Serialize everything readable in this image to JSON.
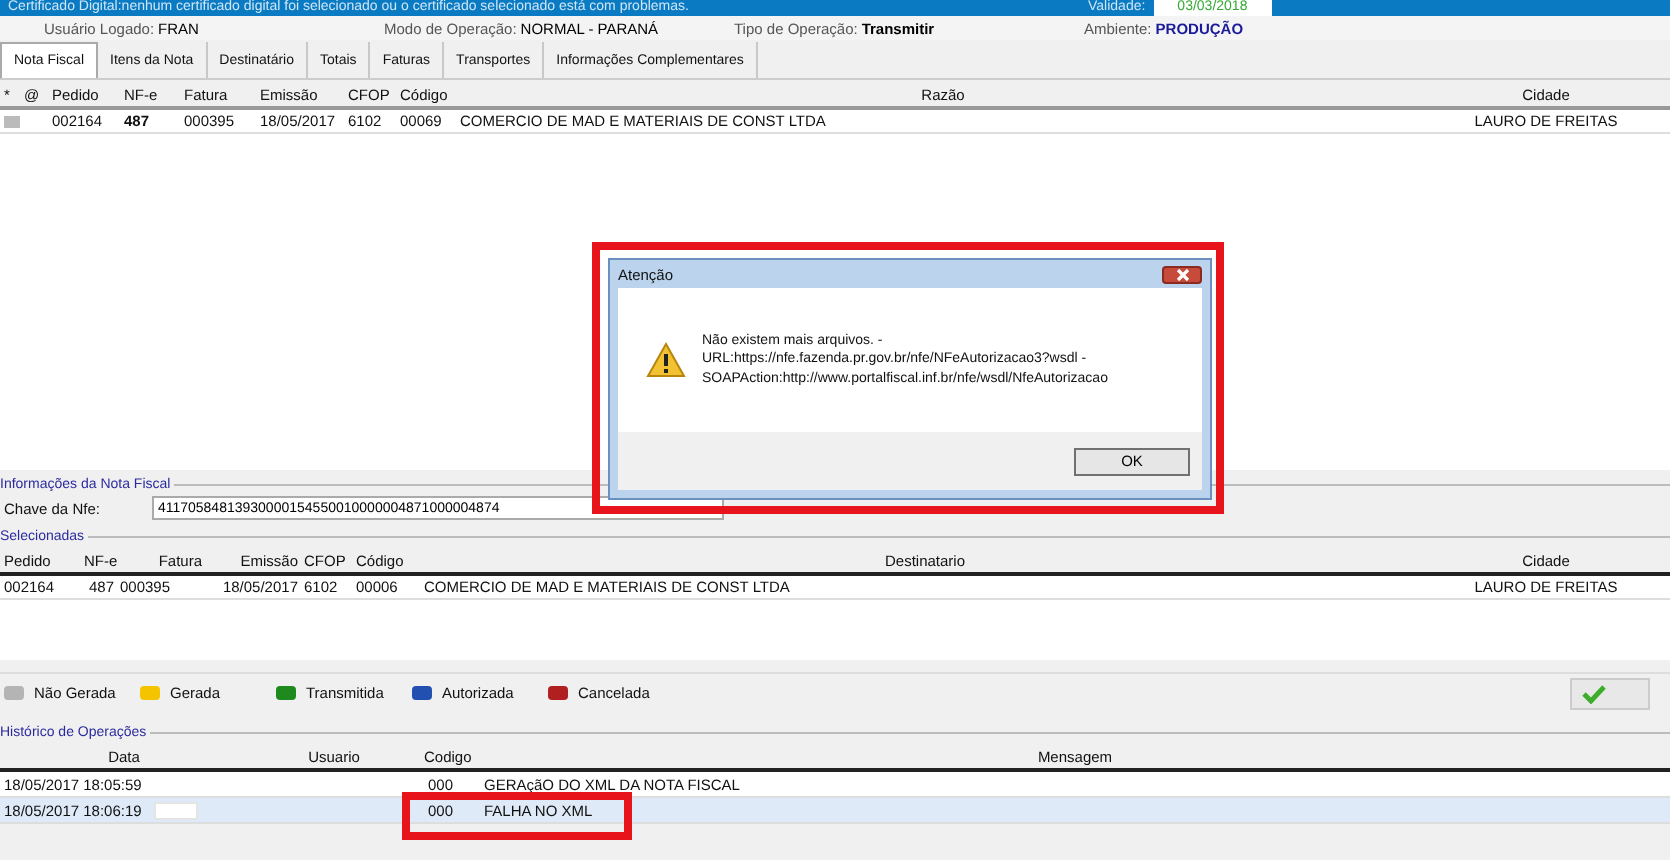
{
  "banner": {
    "text": "Certificado Digital:nenhum certificado digital foi selecionado ou o certificado selecionado está com problemas.",
    "validade_label": "Validade:",
    "validade_value": "03/03/2018"
  },
  "header": [
    {
      "label": "Usuário Logado:",
      "value": "FRAN",
      "color": "#000000"
    },
    {
      "label": "Modo de Operação:",
      "value": "NORMAL - PARANÁ",
      "color": "#000000"
    },
    {
      "label": "Tipo de Operação:",
      "value": "Transmitir",
      "color": "#000000"
    },
    {
      "label": "Ambiente:",
      "value": "PRODUÇÃO",
      "color": "#1a1a9a"
    }
  ],
  "tabs": [
    {
      "label": "Nota Fiscal",
      "selected": true
    },
    {
      "label": "Itens da Nota",
      "selected": false
    },
    {
      "label": "Destinatário",
      "selected": false
    },
    {
      "label": "Totais",
      "selected": false
    },
    {
      "label": "Faturas",
      "selected": false
    },
    {
      "label": "Transportes",
      "selected": false
    },
    {
      "label": "Informações Complementares",
      "selected": false
    }
  ],
  "notas_table": {
    "columns": [
      "*",
      "@",
      "Pedido",
      "NF-e",
      "Fatura",
      "Emissão",
      "CFOP",
      "Código",
      "Razão",
      "Cidade"
    ],
    "rows": [
      {
        "cells": [
          "",
          "",
          "002164",
          "487",
          "000395",
          "18/05/2017",
          "6102",
          "00069",
          "COMERCIO DE MAD E MATERIAIS DE CONST LTDA",
          "LAURO DE FREITAS"
        ]
      }
    ]
  },
  "info": {
    "title": "Informações da Nota Fiscal",
    "chave_label": "Chave da Nfe:",
    "chave_value": "41170584813930000154550010000004871000004874"
  },
  "selecionadas": {
    "title": "Selecionadas",
    "columns": [
      "Pedido",
      "NF-e",
      "Fatura",
      "Emissão",
      "CFOP",
      "Código",
      "Destinatario",
      "Cidade"
    ],
    "rows": [
      {
        "cells": [
          "002164",
          "487",
          "000395",
          "18/05/2017",
          "6102",
          "00006",
          "COMERCIO DE MAD E MATERIAIS DE CONST LTDA",
          "LAURO DE FREITAS"
        ]
      }
    ]
  },
  "legend": [
    {
      "label": "Não Gerada",
      "color": "#b4b4b4"
    },
    {
      "label": "Gerada",
      "color": "#f5c400"
    },
    {
      "label": "Transmitida",
      "color": "#1e8a1e"
    },
    {
      "label": "Autorizada",
      "color": "#2050b0"
    },
    {
      "label": "Cancelada",
      "color": "#b02020"
    }
  ],
  "historico": {
    "title": "Histórico de Operações",
    "columns": [
      "Data",
      "Usuario",
      "Codigo",
      "Mensagem"
    ],
    "rows": [
      {
        "data": "18/05/2017 18:05:59",
        "codigo": "000",
        "mensagem": "GERAçãO DO XML DA NOTA FISCAL",
        "selected": false,
        "redacted": false,
        "annotated": false
      },
      {
        "data": "18/05/2017 18:06:19",
        "codigo": "000",
        "mensagem": "FALHA NO XML",
        "selected": true,
        "redacted": true,
        "annotated": true
      }
    ]
  },
  "dialog": {
    "title": "Atenção",
    "lines": [
      "Não existem mais arquivos. -",
      "URL:https://nfe.fazenda.pr.gov.br/nfe/NFeAutorizacao3?wsdl -",
      "SOAPAction:http://www.portalfiscal.inf.br/nfe/wsdl/NfeAutorizacao"
    ],
    "button": "OK"
  }
}
